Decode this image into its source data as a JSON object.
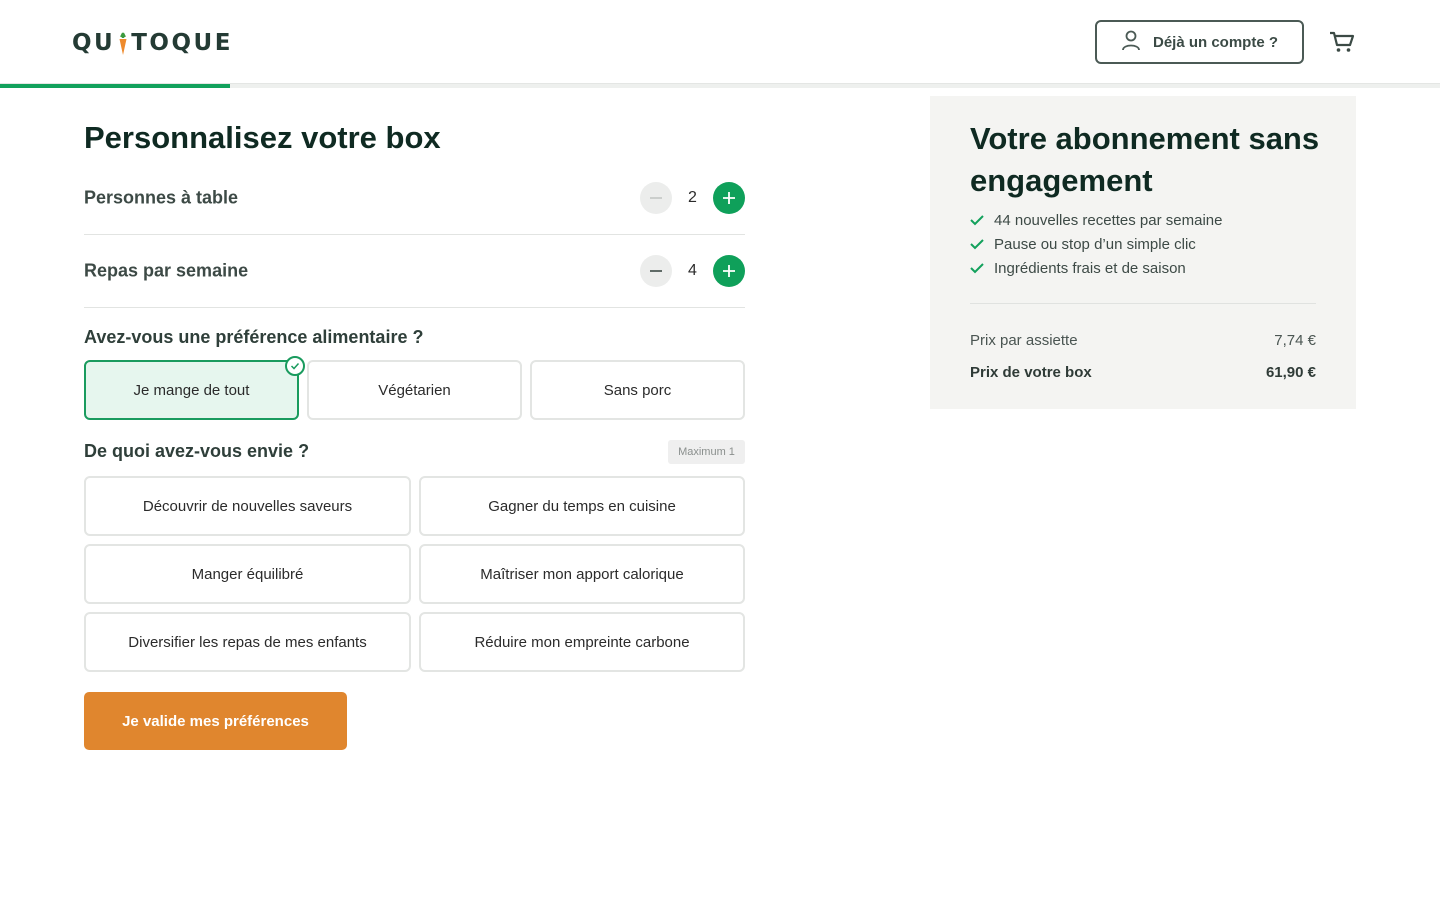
{
  "header": {
    "logo_text": "QUITOQUE",
    "account_label": "Déjà un compte ?",
    "progress_fraction": 0.16,
    "brand_green": "#12a15c"
  },
  "main": {
    "title": "Personnalisez votre box",
    "people": {
      "label": "Personnes à table",
      "value": "2"
    },
    "meals": {
      "label": "Repas par semaine",
      "value": "4"
    },
    "diet": {
      "question": "Avez-vous une préférence alimentaire ?",
      "options": [
        "Je mange de tout",
        "Végétarien",
        "Sans porc"
      ],
      "selected": "Je mange de tout"
    },
    "wishes": {
      "question": "De quoi avez-vous envie ?",
      "max_badge": "Maximum 1",
      "options": [
        "Découvrir de nouvelles saveurs",
        "Gagner du temps en cuisine",
        "Manger équilibré",
        "Maîtriser mon apport calorique",
        "Diversifier les repas de mes enfants",
        "Réduire mon empreinte carbone"
      ]
    },
    "cta_label": "Je valide mes préférences",
    "cta_color": "#e0862e"
  },
  "summary": {
    "title": "Votre abonnement sans engagement",
    "benefits": [
      "44 nouvelles recettes par semaine",
      "Pause ou stop d’un simple clic",
      "Ingrédients frais et de saison"
    ],
    "price_per_plate_label": "Prix par assiette",
    "price_per_plate": "7,74 €",
    "box_price_label": "Prix de votre box",
    "box_price": "61,90 €"
  }
}
